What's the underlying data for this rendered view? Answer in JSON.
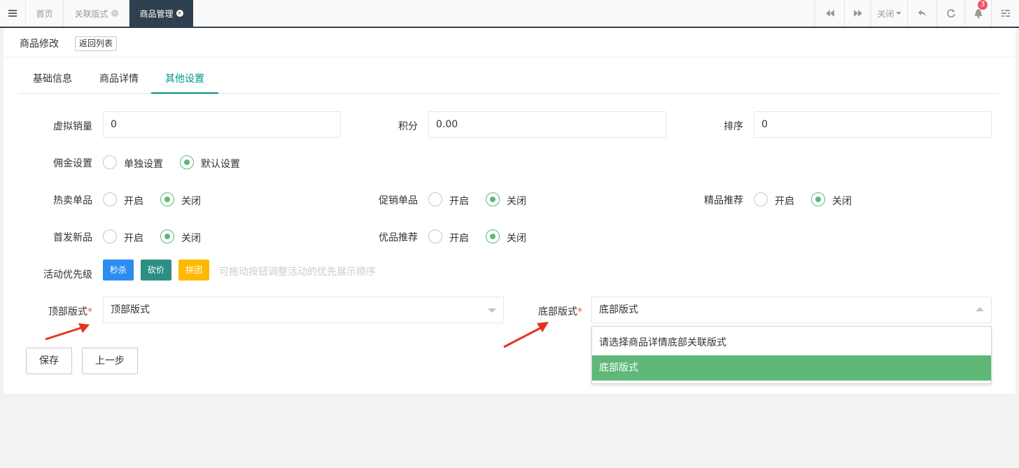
{
  "topbar": {
    "tabs": [
      {
        "label": "首页"
      },
      {
        "label": "关联版式"
      },
      {
        "label": "商品管理"
      }
    ],
    "close_label": "关闭",
    "notification_count": "3"
  },
  "header": {
    "title": "商品修改",
    "back_label": "返回列表"
  },
  "form_tabs": [
    "基础信息",
    "商品详情",
    "其他设置"
  ],
  "fields": {
    "virtual_sales": {
      "label": "虚拟销量",
      "value": "0"
    },
    "points": {
      "label": "积分",
      "value": "0.00"
    },
    "sort": {
      "label": "排序",
      "value": "0"
    }
  },
  "commission": {
    "label": "佣金设置",
    "option_single": "单独设置",
    "option_default": "默认设置",
    "selected": "默认设置"
  },
  "toggles": {
    "open": "开启",
    "close": "关闭",
    "hot": {
      "label": "热卖单品",
      "value": "关闭"
    },
    "promo": {
      "label": "促销单品",
      "value": "关闭"
    },
    "featured": {
      "label": "精品推荐",
      "value": "关闭"
    },
    "first_launch": {
      "label": "首发新品",
      "value": "关闭"
    },
    "quality": {
      "label": "优品推荐",
      "value": "关闭"
    }
  },
  "activity": {
    "label": "活动优先级",
    "buttons": [
      {
        "label": "秒杀",
        "color": "#2d8cf0"
      },
      {
        "label": "砍价",
        "color": "#2d8f84"
      },
      {
        "label": "拼团",
        "color": "#ffb800"
      }
    ],
    "hint": "可拖动按钮调整活动的优先展示顺序"
  },
  "top_layout": {
    "label": "顶部版式",
    "required": "*",
    "value": "顶部版式"
  },
  "bottom_layout": {
    "label": "底部版式",
    "required": "*",
    "value": "底部版式",
    "options": [
      "请选择商品详情底部关联版式",
      "底部版式"
    ],
    "selected_option": "底部版式"
  },
  "actions": {
    "save": "保存",
    "prev": "上一步"
  },
  "colors": {
    "accent": "#009688",
    "radio_on": "#5fb878",
    "topbar_dark": "#2f4050",
    "arrow": "#e8321e"
  }
}
